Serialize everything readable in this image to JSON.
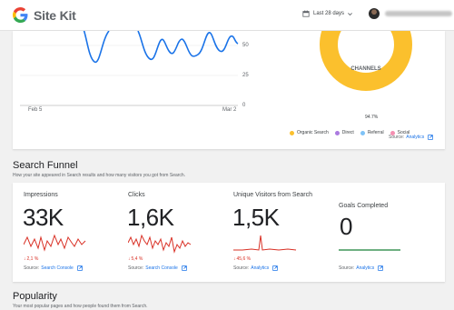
{
  "header": {
    "app_title": "Site Kit",
    "date_range": "Last 28 days"
  },
  "overview": {
    "y_ticks": [
      "50",
      "25",
      "0"
    ],
    "x_ticks": [
      "Feb 5",
      "Mar 2"
    ],
    "channels": {
      "title": "CHANNELS",
      "main_percent": "94.7%",
      "legend": [
        {
          "label": "Organic Search",
          "color": "#fbc02d"
        },
        {
          "label": "Direct",
          "color": "#ab7ae0"
        },
        {
          "label": "Referral",
          "color": "#7fc3f7"
        },
        {
          "label": "Social",
          "color": "#f48fb1"
        }
      ]
    },
    "source_label": "Source:",
    "source_link": "Analytics"
  },
  "search_funnel": {
    "title": "Search Funnel",
    "subtitle": "How your site appeared in Search results and how many visitors you got from Search.",
    "metrics": [
      {
        "label": "Impressions",
        "value": "33K",
        "change": "2,1 %",
        "source_label": "Source:",
        "source_link": "Search Console"
      },
      {
        "label": "Clicks",
        "value": "1,6K",
        "change": "5,4 %",
        "source_label": "Source:",
        "source_link": "Search Console"
      },
      {
        "label": "Unique Visitors from Search",
        "value": "1,5K",
        "change": "45,6 %",
        "source_label": "Source:",
        "source_link": "Analytics"
      },
      {
        "label": "Goals Completed",
        "value": "0",
        "change": "",
        "source_label": "Source:",
        "source_link": "Analytics"
      }
    ],
    "colors": {
      "down": "#d93025",
      "flat": "#188038"
    }
  },
  "popularity": {
    "title": "Popularity",
    "subtitle": "Your most popular pages and how people found them from Search."
  }
}
